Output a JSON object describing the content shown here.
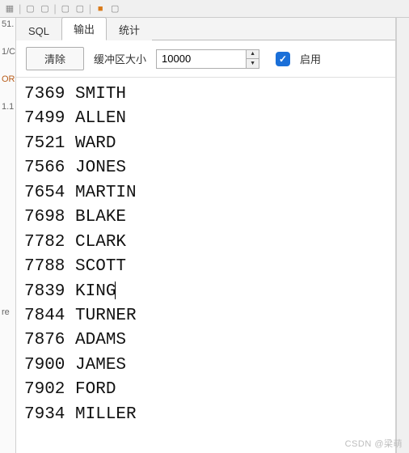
{
  "tabs": {
    "sql": "SQL",
    "output": "输出",
    "stats": "统计"
  },
  "controls": {
    "clear": "清除",
    "buffer_label": "缓冲区大小",
    "buffer_value": "10000",
    "enable_label": "启用"
  },
  "gutter": {
    "l1": "51.",
    "l2": "1/C",
    "l3": "ORC",
    "l4": "1.1",
    "l5": "re"
  },
  "output_rows": [
    {
      "id": "7369",
      "name": "SMITH"
    },
    {
      "id": "7499",
      "name": "ALLEN"
    },
    {
      "id": "7521",
      "name": "WARD"
    },
    {
      "id": "7566",
      "name": "JONES"
    },
    {
      "id": "7654",
      "name": "MARTIN"
    },
    {
      "id": "7698",
      "name": "BLAKE"
    },
    {
      "id": "7782",
      "name": "CLARK"
    },
    {
      "id": "7788",
      "name": "SCOTT"
    },
    {
      "id": "7839",
      "name": "KING",
      "caret": true
    },
    {
      "id": "7844",
      "name": "TURNER"
    },
    {
      "id": "7876",
      "name": "ADAMS"
    },
    {
      "id": "7900",
      "name": "JAMES"
    },
    {
      "id": "7902",
      "name": "FORD"
    },
    {
      "id": "7934",
      "name": "MILLER"
    }
  ],
  "watermark": "CSDN @梁萌"
}
